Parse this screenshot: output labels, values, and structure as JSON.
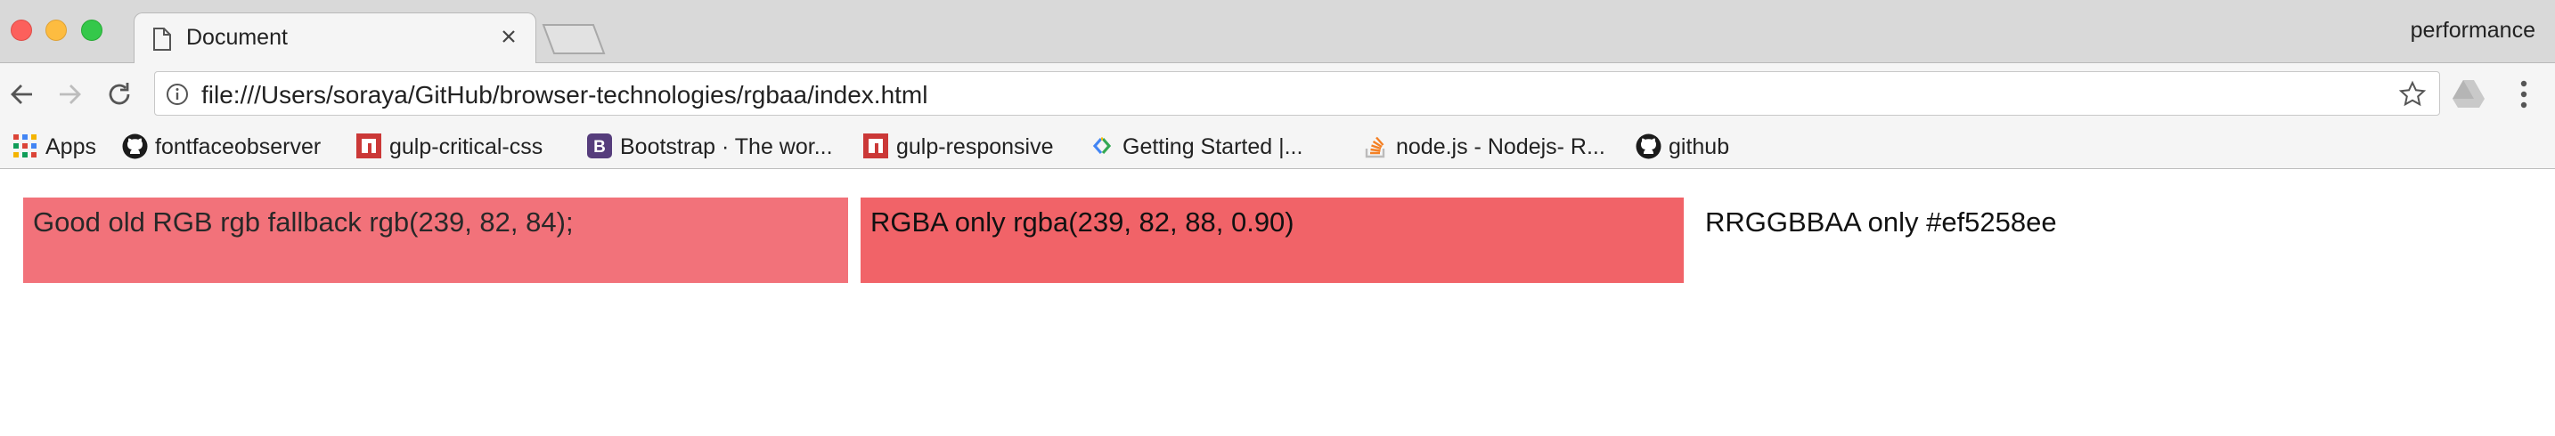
{
  "window": {
    "tab_title": "Document",
    "profile_name": "performance"
  },
  "toolbar": {
    "url": "file:///Users/soraya/GitHub/browser-technologies/rgbaa/index.html"
  },
  "bookmarks": [
    {
      "label": "Apps",
      "icon": "apps-grid-icon"
    },
    {
      "label": "fontfaceobserver",
      "icon": "github-icon"
    },
    {
      "label": "gulp-critical-css",
      "icon": "npm-icon"
    },
    {
      "label": "Bootstrap · The wor...",
      "icon": "bootstrap-icon"
    },
    {
      "label": "gulp-responsive",
      "icon": "npm-icon"
    },
    {
      "label": "Getting Started  |...",
      "icon": "google-chevron-icon"
    },
    {
      "label": "node.js - Nodejs- R...",
      "icon": "stackoverflow-icon"
    },
    {
      "label": "github",
      "icon": "github-icon"
    }
  ],
  "content": {
    "box_rgb": "Good old RGB rgb fallback rgb(239, 82, 84);",
    "box_rgba": "RGBA only rgba(239, 82, 88, 0.90)",
    "box_hex": "RRGGBBAA only #ef5258ee"
  },
  "colors": {
    "rgb_box": "#f1636c",
    "rgba_box": "#f1636c",
    "tab_strip": "#d9d9d9",
    "toolbar": "#f5f5f5"
  }
}
